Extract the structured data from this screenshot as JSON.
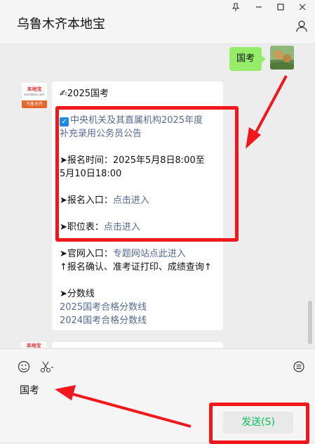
{
  "window": {
    "title": "乌鲁木齐本地宝",
    "pin_icon": "pin-icon",
    "min_icon": "minimize-icon",
    "max_icon": "maximize-icon",
    "close_icon": "close-icon"
  },
  "chat": {
    "my_message": "国考",
    "bot_avatar": {
      "top": "本地宝",
      "middle": "bendibao.com",
      "bottom": "乌鲁木齐"
    },
    "bot_message": {
      "heading_emoji": "✍",
      "heading": "2025国考",
      "check_mark": "✓",
      "notice_title_1": "中央机关及其直属机构2025年度",
      "notice_title_2": "补充录用公务员公告",
      "arrow": "➤",
      "reg_time_1": "报名时间：2025年5月8日8:00至",
      "reg_time_2": "5月10日18:00",
      "reg_entry_label": "报名入口：",
      "reg_entry_link": "点击进入",
      "position_label": "职位表：",
      "position_link": "点击进入",
      "official_label": "官网入口：",
      "official_link": "专题网站点此进入",
      "official_note": "↑报名确认、准考证打印、成绩查询↑",
      "score_label": "分数线",
      "score_link_1": "2025国考合格分数线",
      "score_link_2": "2024国考合格分数线"
    },
    "next_avatar_top": "本地宝"
  },
  "input": {
    "text": "国考",
    "send_label": "发送(S)"
  },
  "colors": {
    "accent_green": "#07c160",
    "bubble_green": "#95ec69",
    "link_blue": "#576b95",
    "annotation_red": "#f0181c"
  }
}
